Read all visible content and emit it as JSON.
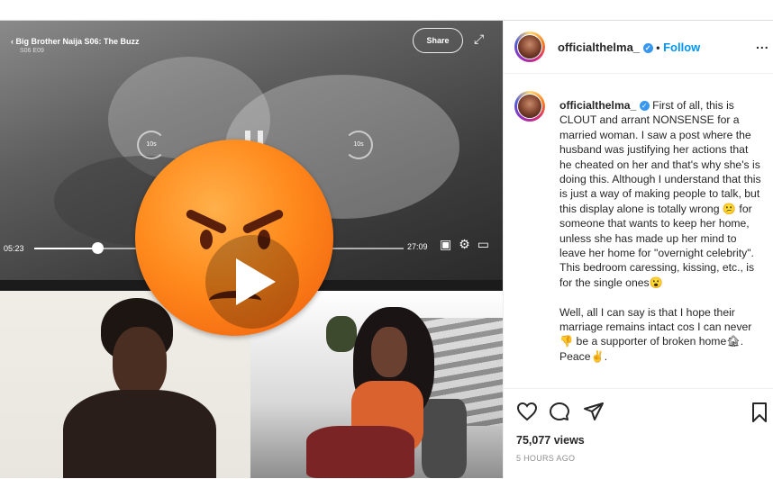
{
  "video": {
    "show_title": "Big Brother Naija S06: The Buzz",
    "episode": "S06 E09",
    "share_label": "Share",
    "rewind_label": "10s",
    "forward_label": "10s",
    "time_elapsed": "05:23",
    "time_remaining": "27:09",
    "progress": 0.17
  },
  "header": {
    "username": "officialthelma_",
    "verified_mark": "✓",
    "separator": "•",
    "follow_label": "Follow",
    "more_label": "..."
  },
  "caption": {
    "username": "officialthelma_",
    "verified_mark": "✓",
    "text": "First of all, this is CLOUT and arrant NONSENSE for a married woman. I saw a post where the husband was justifying her actions that he cheated on her and that's why she's is doing this. Although I understand that this is just a way of making people to talk, but this display alone is totally wrong 😕 for someone that wants to keep her home, unless she has made up her mind to leave her home for \"overnight celebrity\". This bedroom caressing, kissing, etc., is for the single ones😮",
    "text2": "Well, all I can say is that I hope their marriage remains intact cos I can never 👎 be a supporter of broken home🏚. Peace✌."
  },
  "actions": {
    "like_icon": "heart-outline",
    "comment_icon": "speech-bubble",
    "share_icon": "paper-plane",
    "save_icon": "bookmark",
    "views": "75,077 views",
    "time": "5 HOURS AGO"
  }
}
